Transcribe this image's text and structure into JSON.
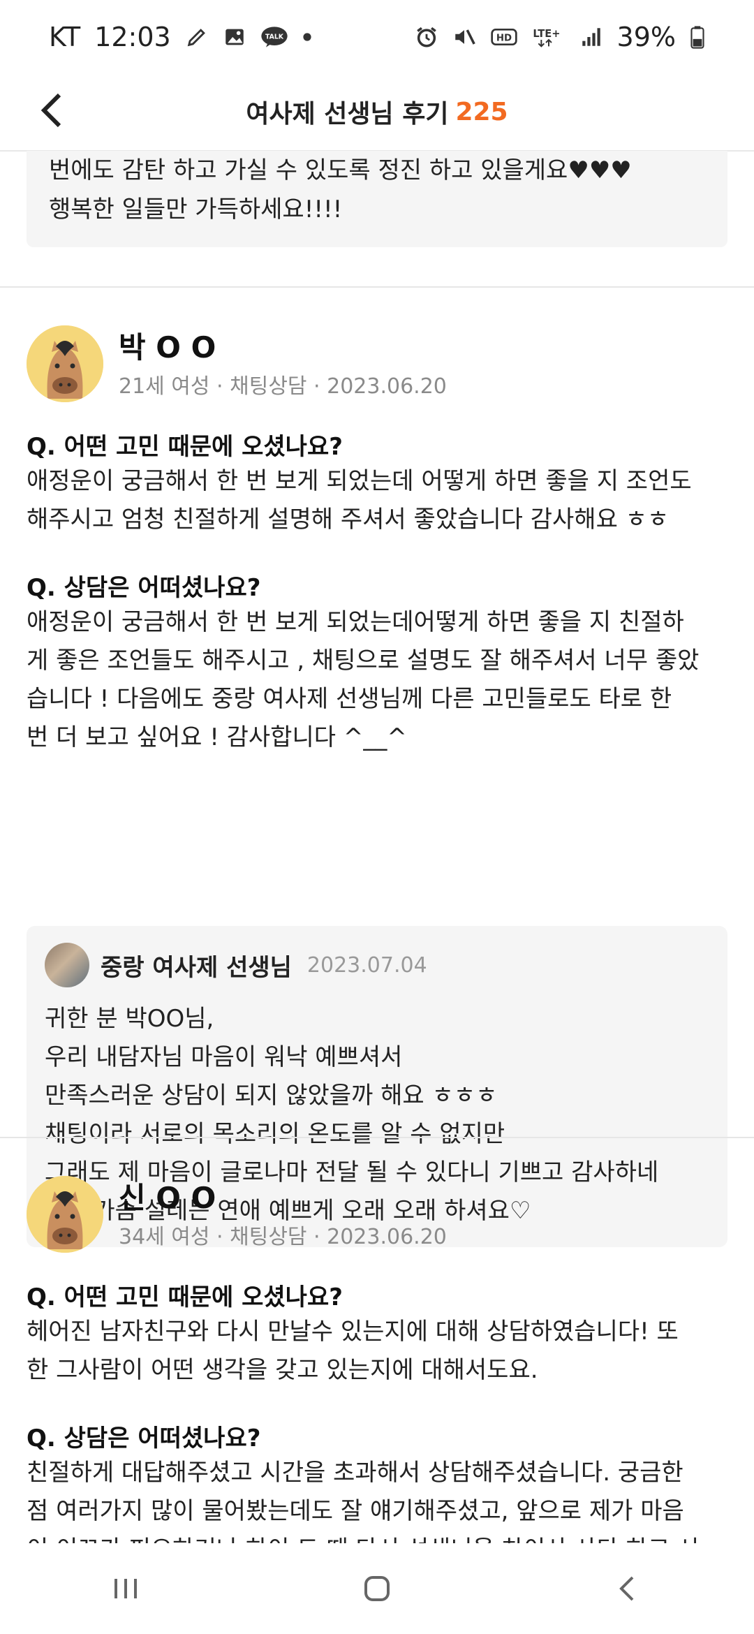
{
  "status_bar": {
    "carrier": "KT",
    "time": "12:03",
    "battery": "39%",
    "icons_left": [
      "pencil-icon",
      "gallery-icon",
      "talk-icon",
      "dot-icon"
    ],
    "icons_right": [
      "alarm-icon",
      "mute-icon",
      "hd-icon",
      "lte-icon",
      "signal-icon",
      "battery-icon"
    ],
    "talk_badge": "TALK",
    "hd_badge": "HD",
    "lte_label": "LTE+"
  },
  "header": {
    "title": "여사제 선생님 후기",
    "count": "225"
  },
  "top_card": {
    "line1": "번에도 감탄 하고 가실 수 있도록 정진 하고 있을게요♥♥♥",
    "line2": "행복한 일들만 가득하세요!!!!"
  },
  "reviews": [
    {
      "name": "박 O O",
      "meta": "21세 여성 · 채팅상담 · 2023.06.20",
      "q1": "Q. 어떤 고민 때문에 오셨나요?",
      "a1_lines": [
        "애정운이 궁금해서 한 번 보게 되었는데 어떻게 하면 좋을 지 조언도",
        "해주시고 엄청 친절하게 설명해 주셔서 좋았습니다 감사해요 ㅎㅎ"
      ],
      "q2": "Q. 상담은 어떠셨나요?",
      "a2_lines": [
        "애정운이 궁금해서 한 번 보게 되었는데어떻게 하면 좋을 지 친절하",
        "게 좋은 조언들도 해주시고 , 채팅으로 설명도 잘 해주셔서 너무 좋았",
        "습니다 ! 다음에도 중랑 여사제 선생님께 다른 고민들로도 타로 한",
        "번 더 보고 싶어요 ! 감사합니다 ^__^"
      ],
      "reply": {
        "counselor": "중랑 여사제 선생님",
        "date": "2023.07.04",
        "body": "귀한 분 박OO님,\n우리 내담자님 마음이 워낙 예쁘셔서\n만족스러운 상담이 되지 않았을까 해요 ㅎㅎㅎ\n채팅이라 서로의 목소리의 온도를 알 수 없지만\n그래도 제 마음이 글로나마 전달 될 수 있다니 기쁘고 감사하네\n요!! 가슴 설레는 연애 예쁘게 오래 오래 하셔요♡"
      }
    },
    {
      "name": "신 O O",
      "meta": "34세 여성 · 채팅상담 · 2023.06.20",
      "q1": "Q. 어떤 고민 때문에 오셨나요?",
      "a1_lines": [
        "헤어진 남자친구와 다시 만날수 있는지에 대해 상담하였습니다! 또",
        "한 그사람이 어떤 생각을 갖고 있는지에 대해서도요."
      ],
      "q2": "Q. 상담은 어떠셨나요?",
      "a2_lines": [
        "친절하게 대답해주셨고 시간을 초과해서 상담해주셨습니다. 궁금한",
        "점 여러가지 많이 물어봤는데도 잘 얘기해주셨고, 앞으로 제가 마음",
        "이 이끄가 피오하거나 하이 드 때 다시 선생니을 차이사 사다 하고 시"
      ]
    }
  ],
  "nav": {
    "icons": [
      "recent-apps-icon",
      "home-icon",
      "back-nav-icon"
    ]
  }
}
